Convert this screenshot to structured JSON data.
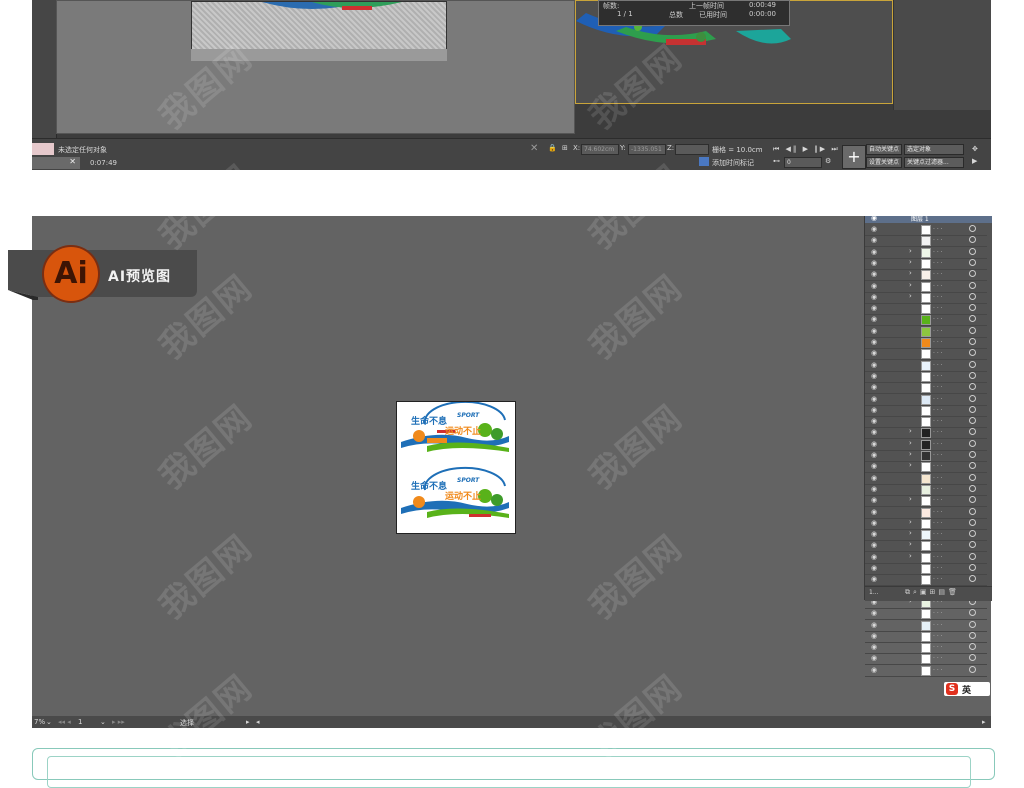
{
  "max_window": {
    "stats": {
      "row1_a": "帧数:",
      "row1_b": "上一帧时间",
      "row1_c": "0:00:49",
      "row2_a": "1 / 1",
      "row2_b": "总数",
      "row2_c": "已用时间",
      "row2_d": "0:00:00"
    },
    "status": {
      "selection_text": "未选定任何对象",
      "time_text": "0:07:49",
      "x_label": "X:",
      "x_value": "74.602cm",
      "y_label": "Y:",
      "y_value": "-1335.051",
      "z_label": "Z:",
      "grid_label": "栅格 = 10.0cm",
      "add_time_tag": "添加时间标记",
      "frame_value": "0",
      "auto_key": "自动关键点",
      "selected_object": "选定对象",
      "set_key": "设置关键点",
      "key_filter": "关键点过滤器..."
    }
  },
  "ai_window": {
    "badge_logo": "Ai",
    "badge_label": "AI预览图",
    "panel": {
      "layer_name": "图层 1",
      "footer_count": "1..."
    },
    "status": {
      "zoom": "7%",
      "artboard_num": "1",
      "tool": "选择"
    },
    "artboard": {
      "title_1": "生命不息",
      "title_2": "运动不止",
      "sport_word": "SPORT"
    },
    "ime_label": "英"
  },
  "watermark_text": "我图网",
  "colors": {
    "badge_circle": "#d8550c",
    "badge_bg": "#4b4b4b",
    "accent_blue": "#1e6fb7",
    "accent_green": "#59b21a",
    "accent_orange": "#f08a1c",
    "frame_border": "#88c9ba"
  }
}
